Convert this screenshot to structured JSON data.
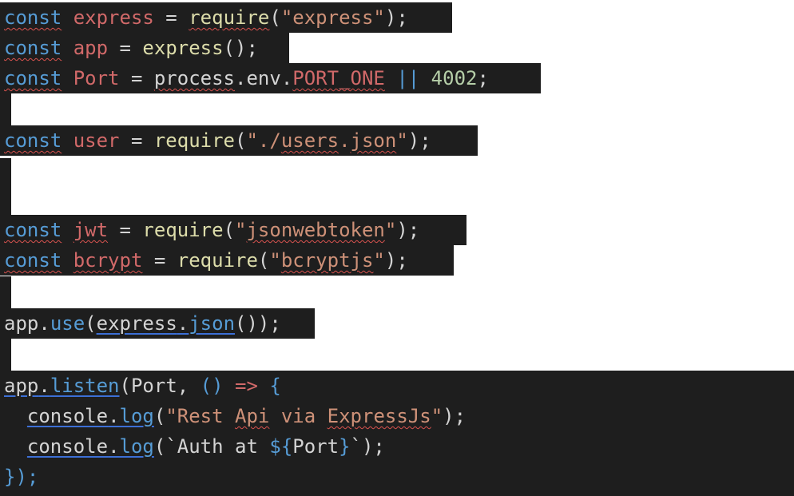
{
  "code_lines": [
    {
      "tokens": [
        [
          "const",
          "kw squig"
        ],
        [
          " ",
          "plain"
        ],
        [
          "express",
          "var"
        ],
        [
          " = ",
          "plain"
        ],
        [
          "require",
          "fn squig"
        ],
        [
          "(",
          "plain"
        ],
        [
          "\"express\"",
          "str"
        ],
        [
          ");",
          "plain"
        ]
      ]
    },
    {
      "tokens": [
        [
          "const",
          "kw squig"
        ],
        [
          " ",
          "plain"
        ],
        [
          "app",
          "var"
        ],
        [
          " = ",
          "plain"
        ],
        [
          "express",
          "fn"
        ],
        [
          "();",
          "plain"
        ]
      ]
    },
    {
      "tokens": [
        [
          "const",
          "kw squig"
        ],
        [
          " ",
          "plain"
        ],
        [
          "Port",
          "var"
        ],
        [
          " = ",
          "plain"
        ],
        [
          "process",
          "plain squig"
        ],
        [
          ".",
          "plain"
        ],
        [
          "env",
          "plain"
        ],
        [
          ".",
          "plain"
        ],
        [
          "PORT_ONE",
          "var squig"
        ],
        [
          " || ",
          "kw"
        ],
        [
          "4002",
          "num"
        ],
        [
          ";",
          "plain"
        ]
      ]
    },
    {
      "tokens": [
        [
          "const",
          "kw squig"
        ],
        [
          " ",
          "plain"
        ],
        [
          "user",
          "var"
        ],
        [
          " = ",
          "plain"
        ],
        [
          "require",
          "fn"
        ],
        [
          "(",
          "plain"
        ],
        [
          "\"./",
          "str"
        ],
        [
          "users",
          "str squig"
        ],
        [
          ".",
          "str"
        ],
        [
          "json",
          "str squig"
        ],
        [
          "\"",
          "str"
        ],
        [
          ");",
          "plain"
        ]
      ]
    },
    {
      "tokens": [
        [
          "const",
          "kw squig"
        ],
        [
          " ",
          "plain"
        ],
        [
          "jwt",
          "var squig"
        ],
        [
          " = ",
          "plain"
        ],
        [
          "require",
          "fn"
        ],
        [
          "(",
          "plain"
        ],
        [
          "\"",
          "str"
        ],
        [
          "jsonwebtoken",
          "str squig"
        ],
        [
          "\"",
          "str"
        ],
        [
          ");",
          "plain"
        ]
      ]
    },
    {
      "tokens": [
        [
          "const",
          "kw squig"
        ],
        [
          " ",
          "plain"
        ],
        [
          "bcrypt",
          "var squig"
        ],
        [
          " = ",
          "plain"
        ],
        [
          "require",
          "fn"
        ],
        [
          "(",
          "plain"
        ],
        [
          "\"",
          "str"
        ],
        [
          "bcryptjs",
          "str squig"
        ],
        [
          "\"",
          "str"
        ],
        [
          ");",
          "plain"
        ]
      ]
    },
    {
      "tokens": [
        [
          "app",
          "plain"
        ],
        [
          ".",
          "plain"
        ],
        [
          "use",
          "kw"
        ],
        [
          "(",
          "plain"
        ],
        [
          "express",
          "plain blue-ul"
        ],
        [
          ".",
          "plain blue-ul"
        ],
        [
          "json",
          "kw blue-ul"
        ],
        [
          "());",
          "plain"
        ]
      ]
    },
    {
      "tokens": [
        [
          "app",
          "plain blue-ul"
        ],
        [
          ".",
          "plain blue-ul"
        ],
        [
          "listen",
          "kw blue-ul"
        ],
        [
          "(",
          "plain"
        ],
        [
          "Port",
          "plain"
        ],
        [
          ", ",
          "plain"
        ],
        [
          "()",
          "kw"
        ],
        [
          " => ",
          "var"
        ],
        [
          "{",
          "kw"
        ]
      ]
    },
    {
      "tokens": [
        [
          "  ",
          "plain"
        ],
        [
          "console",
          "plain blue-ul"
        ],
        [
          ".",
          "plain blue-ul"
        ],
        [
          "log",
          "kw blue-ul"
        ],
        [
          "(",
          "plain"
        ],
        [
          "\"Rest ",
          "str"
        ],
        [
          "Api",
          "str squig"
        ],
        [
          " via ",
          "str"
        ],
        [
          "ExpressJs",
          "str squig"
        ],
        [
          "\"",
          "str"
        ],
        [
          ");",
          "plain"
        ]
      ]
    },
    {
      "tokens": [
        [
          "  ",
          "plain"
        ],
        [
          "console",
          "plain blue-ul"
        ],
        [
          ".",
          "plain blue-ul"
        ],
        [
          "log",
          "kw blue-ul"
        ],
        [
          "(",
          "plain"
        ],
        [
          "`Auth at ",
          "plain"
        ],
        [
          "${",
          "kw"
        ],
        [
          "Port",
          "plain"
        ],
        [
          "}",
          "kw"
        ],
        [
          "`",
          "plain"
        ],
        [
          ");",
          "plain"
        ]
      ]
    },
    {
      "tokens": [
        [
          "});",
          "kw"
        ]
      ]
    }
  ]
}
